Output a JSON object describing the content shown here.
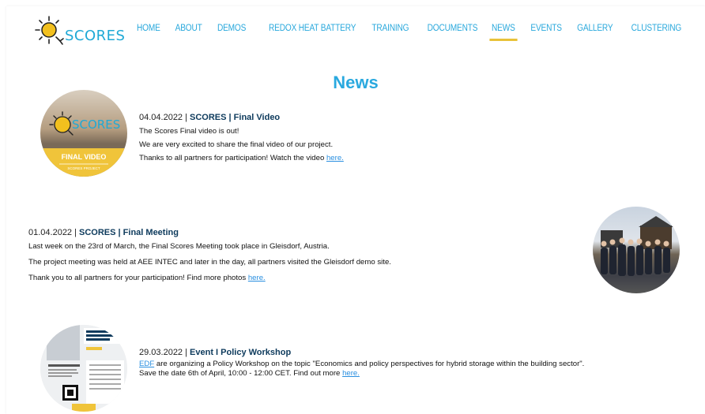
{
  "site": {
    "logo_text": "SCORES"
  },
  "nav": {
    "items": [
      {
        "label": "HOME"
      },
      {
        "label": "ABOUT"
      },
      {
        "label": "DEMOS"
      },
      {
        "label": "REDOX HEAT BATTERY"
      },
      {
        "label": "TRAINING"
      },
      {
        "label": "DOCUMENTS"
      },
      {
        "label": "NEWS",
        "active": true
      },
      {
        "label": "EVENTS"
      },
      {
        "label": "GALLERY"
      },
      {
        "label": "CLUSTERING"
      }
    ]
  },
  "page_title": "News",
  "news": [
    {
      "date": "04.04.2022 | ",
      "title": "SCORES | Final Video",
      "lines": [
        "The Scores Final video is out!",
        "We are very excited to share the final video of our project.",
        "Thanks to all partners for participation! Watch the video "
      ],
      "link": "here.",
      "thumb": {
        "brand": "SCORES",
        "band": "FINAL VIDEO",
        "sub": "SCORES PROJECT"
      }
    },
    {
      "date": "01.04.2022 | ",
      "title": "SCORES | Final Meeting",
      "lines": [
        "Last week on the 23rd of March, the Final Scores Meeting took place in Gleisdorf, Austria.",
        "The project meeting was held at AEE INTEC and later in the day, all partners visited the Gleisdorf demo site.",
        "Thank you to all partners for your participation! Find more photos "
      ],
      "link": "here."
    },
    {
      "date": "29.03.2022 | ",
      "title": "Event I Policy Workshop",
      "lead_link": "EDF",
      "lines": [
        " are organizing a Policy Workshop on the topic \"Economics and policy perspectives for hybrid storage within the building sector\".",
        "Save the date 6th of April, 10:00 - 12:00 CET. Find out more "
      ],
      "link": "here."
    }
  ],
  "colors": {
    "accent": "#2aa9df",
    "underline": "#e8c23a",
    "title_dark": "#0d3a5c",
    "link": "#2a8fe0"
  }
}
